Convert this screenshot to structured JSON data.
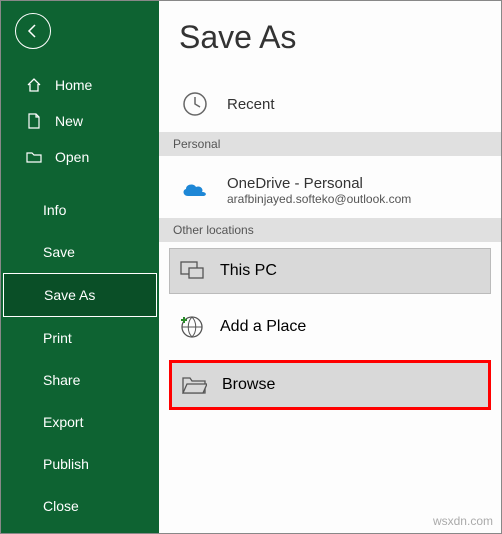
{
  "sidebar": {
    "primary": [
      {
        "label": "Home",
        "name": "nav-home"
      },
      {
        "label": "New",
        "name": "nav-new"
      },
      {
        "label": "Open",
        "name": "nav-open"
      }
    ],
    "secondary": [
      {
        "label": "Info",
        "name": "nav-info"
      },
      {
        "label": "Save",
        "name": "nav-save"
      },
      {
        "label": "Save As",
        "name": "nav-save-as",
        "selected": true
      },
      {
        "label": "Print",
        "name": "nav-print"
      },
      {
        "label": "Share",
        "name": "nav-share"
      },
      {
        "label": "Export",
        "name": "nav-export"
      },
      {
        "label": "Publish",
        "name": "nav-publish"
      },
      {
        "label": "Close",
        "name": "nav-close"
      }
    ]
  },
  "main": {
    "title": "Save As",
    "recent_label": "Recent",
    "section_personal": "Personal",
    "onedrive_label": "OneDrive - Personal",
    "onedrive_email": "arafbinjayed.softeko@outlook.com",
    "section_other": "Other locations",
    "thispc_label": "This PC",
    "addplace_label": "Add a Place",
    "browse_label": "Browse"
  },
  "watermark": "wsxdn.com"
}
